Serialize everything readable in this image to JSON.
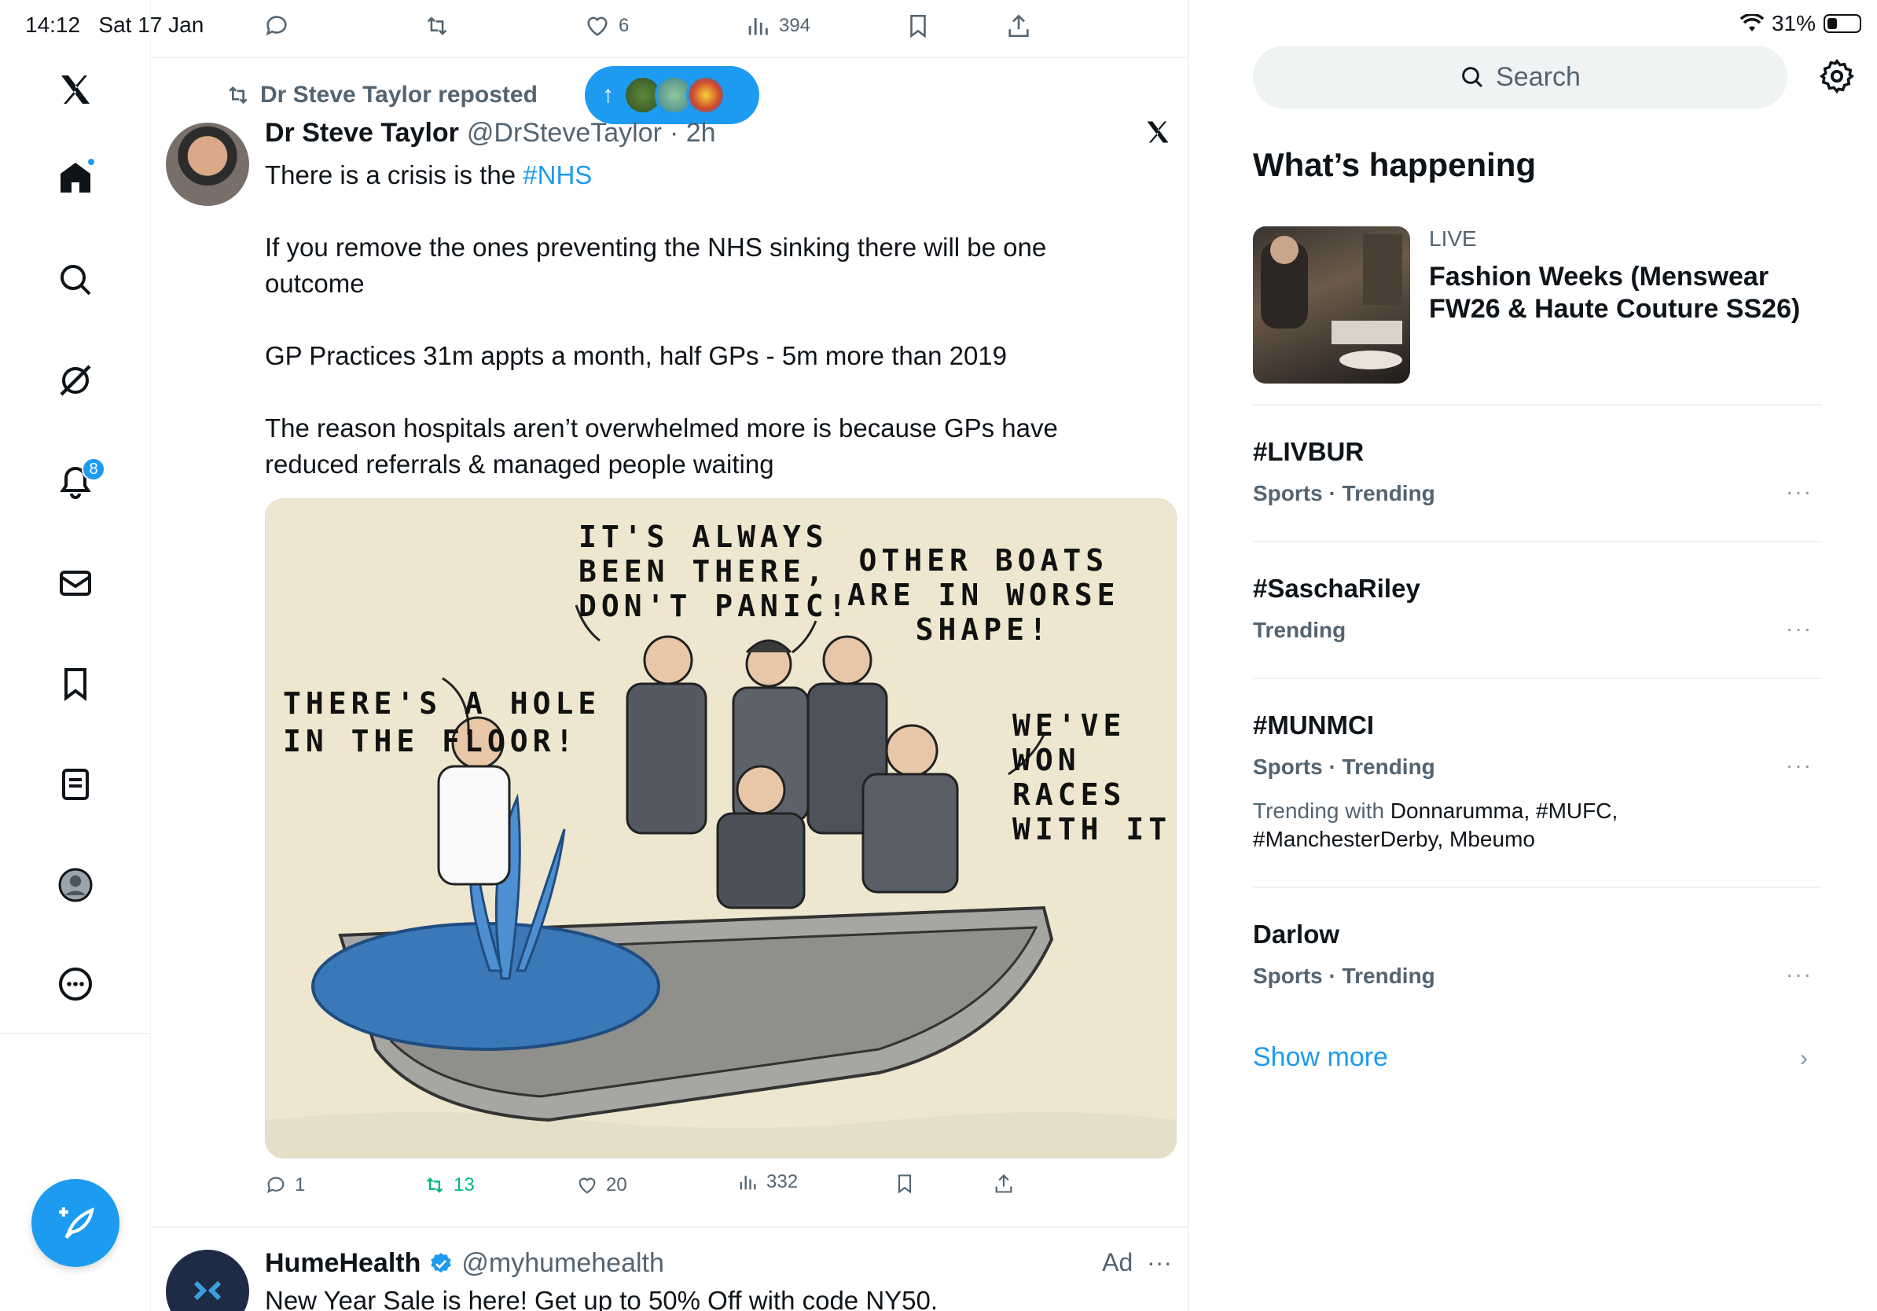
{
  "status": {
    "time": "14:12",
    "date": "Sat 17 Jan",
    "battery": "31%",
    "battery_level": 0.31
  },
  "nav": {
    "notifications_badge": "8"
  },
  "top_actions": {
    "replies": "",
    "likes": "6",
    "views": "394"
  },
  "tweet": {
    "repost_by": "Dr Steve Taylor reposted",
    "author_name": "Dr Steve Taylor",
    "author_handle": "@DrSteveTaylor",
    "time": "· 2h",
    "text_line1_prefix": "There is a crisis is the ",
    "text_line1_tag": "#NHS",
    "para2": "If you remove the ones preventing the NHS sinking there will be one outcome",
    "para3": "GP Practices 31m appts a month, half GPs - 5m more than 2019",
    "para4": "The reason hospitals aren’t overwhelmed more is because GPs have reduced referrals & managed people waiting",
    "cartoon": {
      "bubble1": "IT'S ALWAYS\nBEEN THERE,\nDON'T PANIC!",
      "bubble2": "OTHER BOATS\nARE IN WORSE\nSHAPE!",
      "bubble3": "THERE'S A HOLE\nIN THE FLOOR!",
      "bubble4": "WE'VE\nWON\nRACES\nWITH IT!"
    },
    "replies": "1",
    "reposts": "13",
    "likes": "20",
    "views": "332"
  },
  "ad": {
    "name": "HumeHealth",
    "handle": "@myhumehealth",
    "label": "Ad",
    "more": "···",
    "text": "New Year Sale is here! Get up to 50% Off with code NY50."
  },
  "sidebar": {
    "search_placeholder": "Search",
    "title": "What’s happening",
    "live": {
      "label": "LIVE",
      "title": "Fashion Weeks (Menswear FW26 & Haute Couture SS26)"
    },
    "trends": [
      {
        "name": "#LIVBUR",
        "category": "Sports · Trending"
      },
      {
        "name": "#SaschaRiley",
        "category": "Trending"
      },
      {
        "name": "#MUNMCI",
        "category": "Sports · Trending",
        "with_label": "Trending with",
        "with_value": "Donnarumma, #MUFC, #ManchesterDerby, Mbeumo"
      },
      {
        "name": "Darlow",
        "category": "Sports · Trending"
      }
    ],
    "more": "···",
    "show_more": "Show more"
  },
  "colors": {
    "accent": "#1d9bf0",
    "repost_green": "#00ba7c",
    "muted": "#536471"
  }
}
